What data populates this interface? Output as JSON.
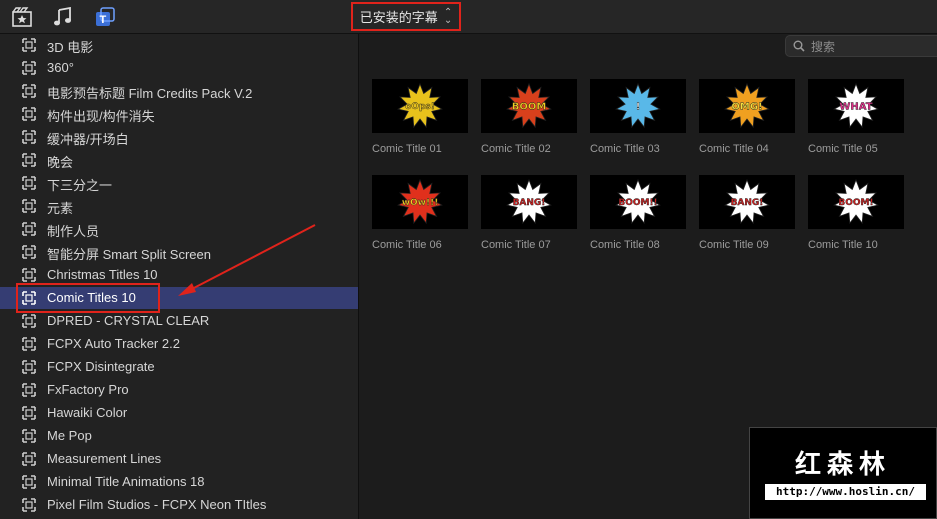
{
  "toolbar": {
    "icons": [
      "clapper-star-icon",
      "music-note-icon",
      "titles-icon"
    ],
    "dropdown_label": "已安装的字幕"
  },
  "sidebar": {
    "items": [
      {
        "label": "3D 电影",
        "selected": false
      },
      {
        "label": "360°",
        "selected": false
      },
      {
        "label": "电影预告标题 Film Credits Pack V.2",
        "selected": false
      },
      {
        "label": "构件出现/构件消失",
        "selected": false
      },
      {
        "label": "缓冲器/开场白",
        "selected": false
      },
      {
        "label": "晚会",
        "selected": false
      },
      {
        "label": "下三分之一",
        "selected": false
      },
      {
        "label": "元素",
        "selected": false
      },
      {
        "label": "制作人员",
        "selected": false
      },
      {
        "label": "智能分屏 Smart Split Screen",
        "selected": false
      },
      {
        "label": "Christmas Titles 10",
        "selected": false
      },
      {
        "label": "Comic Titles 10",
        "selected": true
      },
      {
        "label": "DPRED - CRYSTAL CLEAR",
        "selected": false
      },
      {
        "label": "FCPX Auto Tracker 2.2",
        "selected": false
      },
      {
        "label": "FCPX Disintegrate",
        "selected": false
      },
      {
        "label": "FxFactory Pro",
        "selected": false
      },
      {
        "label": "Hawaiki Color",
        "selected": false
      },
      {
        "label": "Me Pop",
        "selected": false
      },
      {
        "label": "Measurement Lines",
        "selected": false
      },
      {
        "label": "Minimal Title Animations 18",
        "selected": false
      },
      {
        "label": "Pixel Film Studios - FCPX Neon TItles",
        "selected": false
      }
    ]
  },
  "search": {
    "placeholder": "搜索"
  },
  "thumbnails": [
    {
      "name": "Comic Title 01",
      "art_text": "oOps!",
      "burst": "#e8c21c",
      "text_color": "#e8c21c"
    },
    {
      "name": "Comic Title 02",
      "art_text": "BOOM",
      "burst": "#d8401c",
      "text_color": "#f0d020"
    },
    {
      "name": "Comic Title 03",
      "art_text": "!",
      "burst": "#59b8e8",
      "text_color": "#ffffff"
    },
    {
      "name": "Comic Title 04",
      "art_text": "OMG!",
      "burst": "#f0a020",
      "text_color": "#f4e040"
    },
    {
      "name": "Comic Title 05",
      "art_text": "WHAT",
      "burst": "#ffffff",
      "text_color": "#e0308a"
    },
    {
      "name": "Comic Title 06",
      "art_text": "wOw!!!",
      "burst": "#e0301c",
      "text_color": "#f8d020"
    },
    {
      "name": "Comic Title 07",
      "art_text": "BANG!",
      "burst": "#ffffff",
      "text_color": "#d02020"
    },
    {
      "name": "Comic Title 08",
      "art_text": "BOOM!!",
      "burst": "#ffffff",
      "text_color": "#d02020"
    },
    {
      "name": "Comic Title 09",
      "art_text": "BANG!",
      "burst": "#ffffff",
      "text_color": "#d02020"
    },
    {
      "name": "Comic Title 10",
      "art_text": "BOOM!",
      "burst": "#ffffff",
      "text_color": "#d02020"
    }
  ],
  "watermark": {
    "title": "红森林",
    "url": "http://www.hoslin.cn/"
  },
  "colors": {
    "selection": "#353d73",
    "highlight": "#e0231b",
    "background": "#1e1e1e"
  }
}
